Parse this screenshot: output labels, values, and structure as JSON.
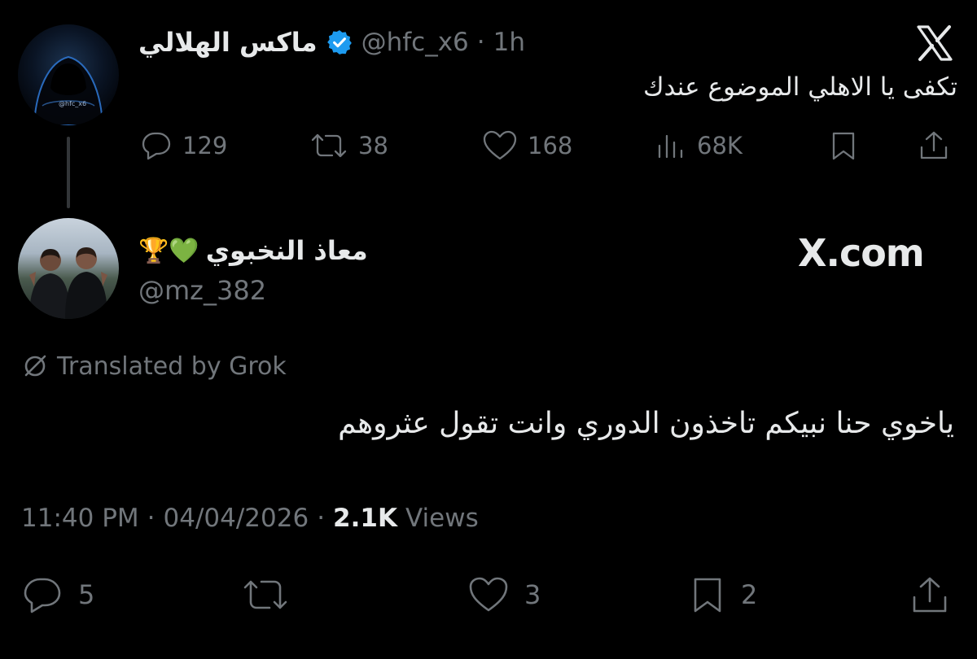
{
  "brand": {
    "x_glyph": "X",
    "watermark": "X.com"
  },
  "parent_tweet": {
    "display_name": "ماكس الهلالي",
    "handle": "@hfc_x6",
    "separator": "·",
    "time": "1h",
    "text": "تكفى يا الاهلي الموضوع عندك",
    "avatar_caption": "@hfc_x6",
    "actions": {
      "replies": "129",
      "reposts": "38",
      "likes": "168",
      "views": "68K"
    }
  },
  "reply_tweet": {
    "display_name": "معاذ النخبوي",
    "name_emojis": "🏆💚",
    "handle": "@mz_382",
    "translated_label": "Translated by Grok",
    "text": "ياخوي حنا نبيكم تاخذون الدوري وانت تقول عثروهم",
    "meta": {
      "time": "11:40 PM",
      "sep1": "·",
      "date": "04/04/2026",
      "sep2": "·",
      "views_count": "2.1K",
      "views_label": "Views"
    },
    "actions": {
      "replies": "5",
      "likes": "3",
      "bookmarks": "2"
    }
  },
  "colors": {
    "background": "#000000",
    "text": "#e7e9ea",
    "muted": "#71767b",
    "verified": "#1d9bf0"
  }
}
